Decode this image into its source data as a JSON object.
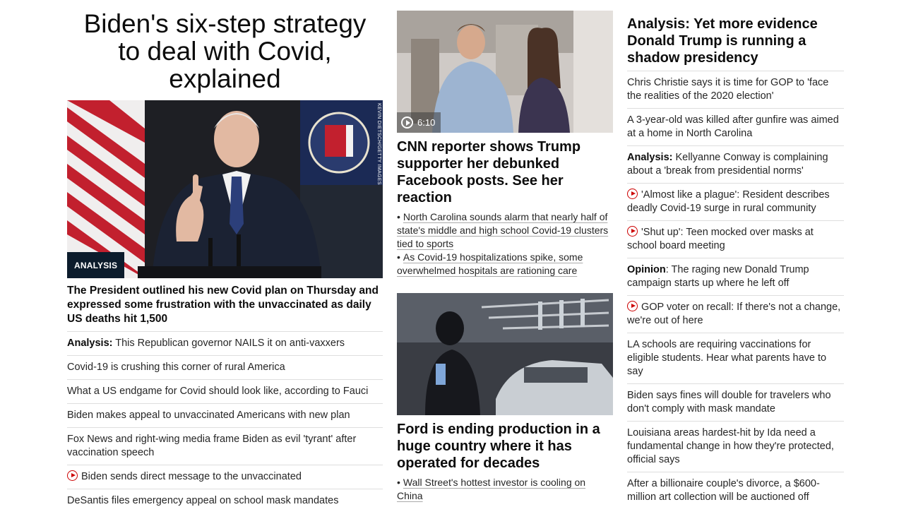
{
  "lead": {
    "headline_lines": [
      "Biden's six-step strategy",
      "to deal with Covid,",
      "explained"
    ],
    "badge": "ANALYSIS",
    "photo_credit": "KEVIN DIETSCH/GETTY IMAGES",
    "dek": "The President outlined his new Covid plan on Thursday and expressed some frustration with the unvaccinated as daily US deaths hit 1,500",
    "stories": [
      {
        "prefix": "Analysis:",
        "text": "This Republican governor NAILS it on anti-vaxxers",
        "video": false
      },
      {
        "prefix": "",
        "text": "Covid-19 is crushing this corner of rural America",
        "video": false
      },
      {
        "prefix": "",
        "text": "What a US endgame for Covid should look like, according to Fauci",
        "video": false
      },
      {
        "prefix": "",
        "text": "Biden makes appeal to unvaccinated Americans with new plan",
        "video": false
      },
      {
        "prefix": "",
        "text": "Fox News and right-wing media frame Biden as evil 'tyrant' after vaccination speech",
        "video": false
      },
      {
        "prefix": "",
        "text": "Biden sends direct message to the unvaccinated",
        "video": true
      },
      {
        "prefix": "",
        "text": "DeSantis files emergency appeal on school mask mandates",
        "video": false
      }
    ]
  },
  "middle": {
    "card1": {
      "video_duration": "6:10",
      "title": "CNN reporter shows Trump supporter her debunked Facebook posts. See her reaction",
      "bullets": [
        "North Carolina sounds alarm that nearly half of state's middle and high school Covid-19 clusters tied to sports",
        "As Covid-19 hospitalizations spike, some overwhelmed hospitals are rationing care"
      ]
    },
    "card2": {
      "title": "Ford is ending production in a huge country where it has operated for decades",
      "bullets": [
        "Wall Street's hottest investor is cooling on China"
      ]
    }
  },
  "right": {
    "headline": "Analysis: Yet more evidence Donald Trump is running a shadow presidency",
    "stories": [
      {
        "prefix": "",
        "text": "Chris Christie says it is time for GOP to 'face the realities of the 2020 election'",
        "video": false
      },
      {
        "prefix": "",
        "text": "A 3-year-old was killed after gunfire was aimed at a home in North Carolina",
        "video": false
      },
      {
        "prefix": "Analysis:",
        "text": "Kellyanne Conway is complaining about a 'break from presidential norms'",
        "video": false
      },
      {
        "prefix": "",
        "text": "'Almost like a plague': Resident describes deadly Covid-19 surge in rural community",
        "video": true
      },
      {
        "prefix": "",
        "text": "'Shut up': Teen mocked over masks at school board meeting",
        "video": true
      },
      {
        "prefix": "Opinion",
        "text": ": The raging new Donald Trump campaign starts up where he left off",
        "video": false
      },
      {
        "prefix": "",
        "text": "GOP voter on recall: If there's not a change, we're out of here",
        "video": true
      },
      {
        "prefix": "",
        "text": "LA schools are requiring vaccinations for eligible students. Hear what parents have to say",
        "video": false
      },
      {
        "prefix": "",
        "text": "Biden says fines will double for travelers who don't comply with mask mandate",
        "video": false
      },
      {
        "prefix": "",
        "text": "Louisiana areas hardest-hit by Ida need a fundamental change in how they're protected, official says",
        "video": false
      },
      {
        "prefix": "",
        "text": "After a billionaire couple's divorce, a $600-million art collection will be auctioned off",
        "video": false
      }
    ]
  },
  "colors": {
    "text": "#262626",
    "headline": "#0c0c0c",
    "divider": "#dedede",
    "video_red": "#cc0000",
    "badge_bg": "#0c1c2c"
  }
}
